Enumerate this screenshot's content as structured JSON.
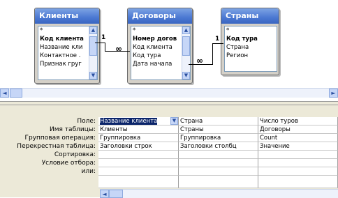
{
  "tables": [
    {
      "title": "Клиенты",
      "fields": [
        "*",
        "Код клиента",
        "Название кли",
        "Контактное .",
        "Признак груг"
      ],
      "key_index": 1
    },
    {
      "title": "Договоры",
      "fields": [
        "*",
        "Номер догов",
        "Код клиента",
        "Код тура",
        "Дата начала"
      ],
      "key_index": 1
    },
    {
      "title": "Страны",
      "fields": [
        "*",
        "Код тура",
        "Страна",
        "Регион"
      ],
      "key_index": 1
    }
  ],
  "relations": [
    {
      "one": "1",
      "many": "∞"
    },
    {
      "one": "1",
      "many": "∞"
    }
  ],
  "grid": {
    "row_labels": [
      "Поле:",
      "Имя таблицы:",
      "Групповая операция:",
      "Перекрестная таблица:",
      "Сортировка:",
      "Условие отбора:",
      "или:"
    ],
    "columns": [
      {
        "values": [
          "Название клиента",
          "Клиенты",
          "Группировка",
          "Заголовки строк",
          "",
          "",
          ""
        ],
        "selected": true
      },
      {
        "values": [
          "Страна",
          "Страны",
          "Группировка",
          "Заголовки столбц",
          "",
          "",
          ""
        ],
        "selected": false
      },
      {
        "values": [
          "Число туров",
          "Договоры",
          "Count",
          "Значение",
          "",
          "",
          ""
        ],
        "selected": false
      }
    ]
  },
  "icons": {
    "scroll_up": "▲",
    "scroll_down": "▼",
    "scroll_left": "◄",
    "scroll_right": "►",
    "dropdown": "▼"
  }
}
